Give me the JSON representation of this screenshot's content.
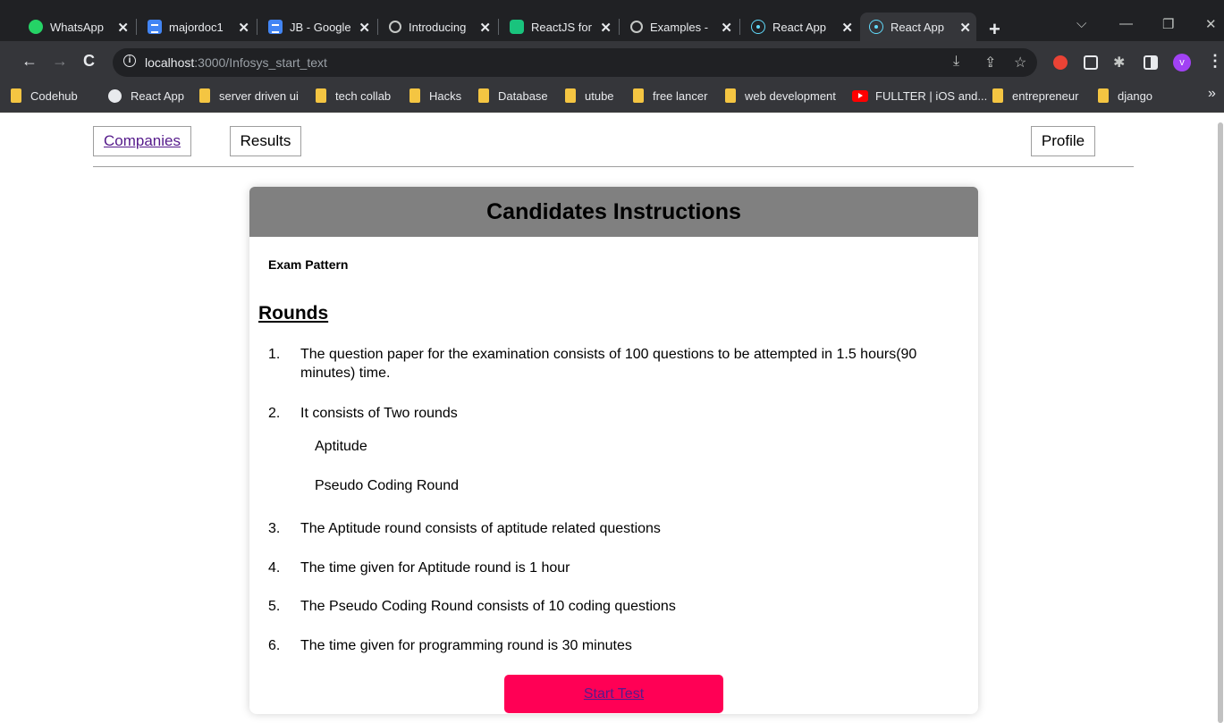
{
  "browser": {
    "tabs": [
      {
        "label": "WhatsApp",
        "icon": "whatsapp-icon"
      },
      {
        "label": "majordoc1",
        "icon": "google-docs-icon"
      },
      {
        "label": "JB - Google",
        "icon": "google-docs-icon"
      },
      {
        "label": "Introducing",
        "icon": "openai-icon"
      },
      {
        "label": "ReactJS for",
        "icon": "chatgpt-icon"
      },
      {
        "label": "Examples -",
        "icon": "openai-icon"
      },
      {
        "label": "React App",
        "icon": "react-icon"
      },
      {
        "label": "React App",
        "icon": "react-icon"
      }
    ],
    "close_glyph": "✕",
    "new_tab_glyph": "+",
    "window_controls": {
      "list": "⌵",
      "minimize": "—",
      "restore": "❐",
      "close": "✕"
    },
    "nav": {
      "back": "←",
      "forward": "→",
      "reload": "C"
    },
    "url_host": "localhost",
    "url_rest": ":3000/Infosys_start_text",
    "profile_initial": "v",
    "bookmarks": [
      {
        "label": "Codehub",
        "icon": "folder-icon"
      },
      {
        "label": "React App",
        "icon": "globe-icon"
      },
      {
        "label": "server driven ui",
        "icon": "folder-icon"
      },
      {
        "label": "tech collab",
        "icon": "folder-icon"
      },
      {
        "label": "Hacks",
        "icon": "folder-icon"
      },
      {
        "label": "Database",
        "icon": "folder-icon"
      },
      {
        "label": "utube",
        "icon": "folder-icon"
      },
      {
        "label": "free lancer",
        "icon": "folder-icon"
      },
      {
        "label": "web development",
        "icon": "folder-icon"
      },
      {
        "label": "FULLTER | iOS and...",
        "icon": "youtube-icon"
      },
      {
        "label": "entrepreneur",
        "icon": "folder-icon"
      },
      {
        "label": "django",
        "icon": "folder-icon"
      }
    ],
    "bookmarks_more": "»"
  },
  "page": {
    "nav": {
      "companies": "Companies",
      "results": "Results",
      "profile": "Profile"
    },
    "card": {
      "title": "Candidates Instructions",
      "exam_pattern": "Exam Pattern",
      "rounds_heading": "Rounds",
      "items": [
        {
          "num": "1.",
          "text": "The question paper for the examination consists of 100 questions to be attempted in 1.5 hours(90 minutes) time."
        },
        {
          "num": "2.",
          "text": "It consists of Two rounds"
        },
        {
          "num": "3.",
          "text": "The Aptitude round consists of aptitude related questions"
        },
        {
          "num": "4.",
          "text": "The time given for Aptitude round is 1 hour"
        },
        {
          "num": "5.",
          "text": "The Pseudo Coding Round consists of 10 coding questions"
        },
        {
          "num": "6.",
          "text": "The time given for programming round is 30 minutes"
        }
      ],
      "sub_items": [
        "Aptitude",
        "Pseudo Coding Round"
      ],
      "start_button": "Start Test"
    }
  },
  "colors": {
    "header_bg": "#808080",
    "start_button_bg": "#ff0055",
    "link_visited": "#551a8b"
  }
}
